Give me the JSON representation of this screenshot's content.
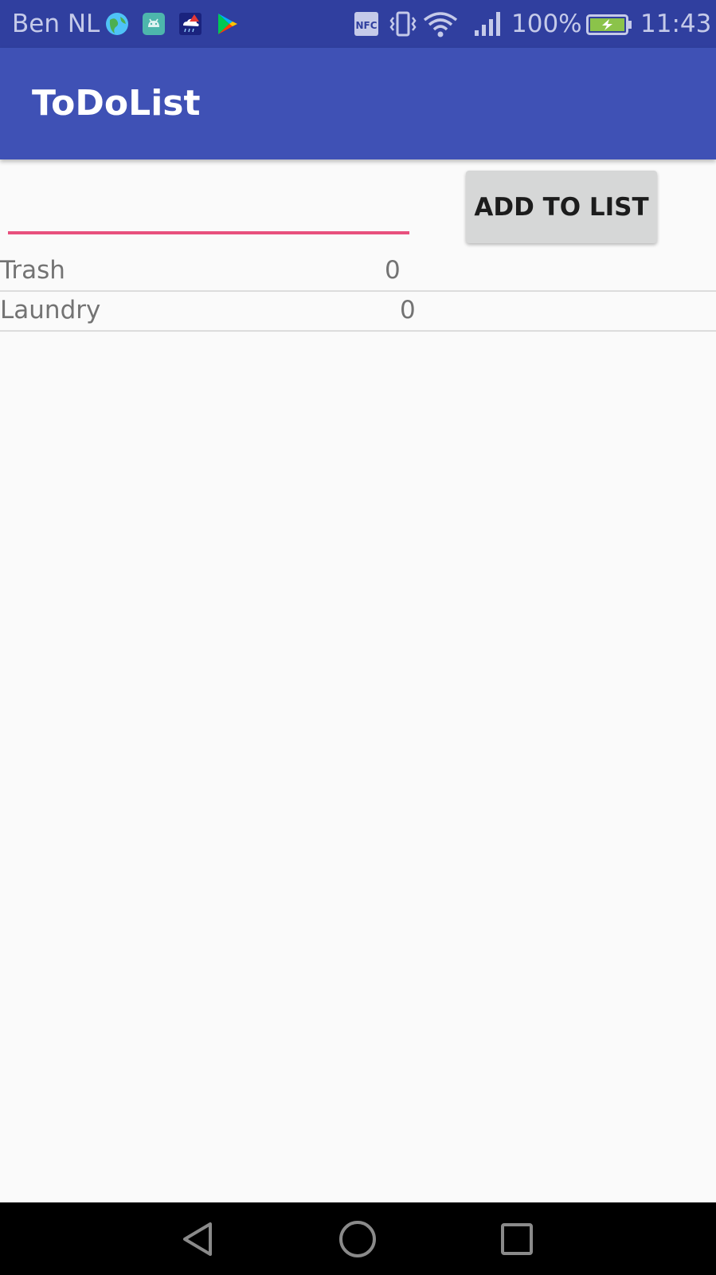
{
  "status_bar": {
    "carrier": "Ben NL",
    "battery_percent": "100%",
    "time": "11:43",
    "notification_icons": [
      "globe-icon",
      "android-icon",
      "weather-alert-icon",
      "play-store-icon"
    ],
    "system_icons": [
      "nfc-icon",
      "vibrate-icon",
      "wifi-icon",
      "signal-icon",
      "battery-charging-icon"
    ],
    "background_color": "#303f9f"
  },
  "app_bar": {
    "title": "ToDoList",
    "background_color": "#3f51b5"
  },
  "input": {
    "value": "",
    "placeholder": "",
    "underline_color": "#e8507d"
  },
  "add_button": {
    "label": "ADD TO LIST"
  },
  "list": [
    {
      "name": "Trash",
      "count": "0"
    },
    {
      "name": "Laundry",
      "count": "0"
    }
  ],
  "nav_bar": {
    "buttons": [
      "back-icon",
      "home-icon",
      "recents-icon"
    ]
  }
}
